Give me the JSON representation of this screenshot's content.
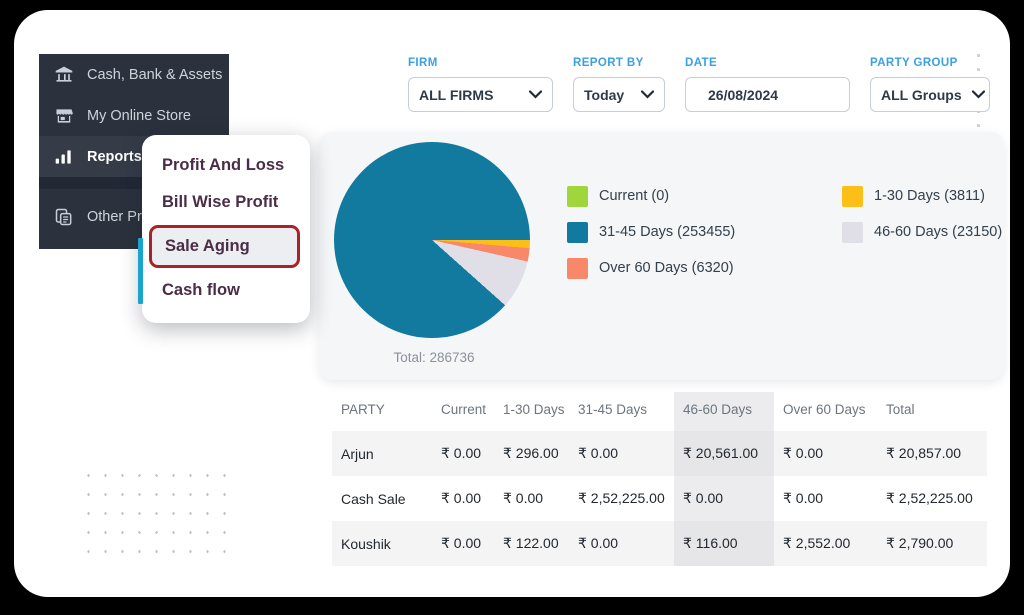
{
  "sidebar": {
    "items": [
      {
        "label": "Cash, Bank & Assets",
        "icon": "bank-icon",
        "active": false
      },
      {
        "label": "My Online Store",
        "icon": "store-icon",
        "active": false
      },
      {
        "label": "Reports",
        "icon": "bar-chart-icon",
        "active": true
      },
      {
        "label": "Other Pr",
        "icon": "documents-icon",
        "active": false
      }
    ]
  },
  "flyout": {
    "items": [
      {
        "label": "Profit And Loss",
        "selected": false
      },
      {
        "label": "Bill Wise Profit",
        "selected": false
      },
      {
        "label": "Sale Aging",
        "selected": true
      },
      {
        "label": "Cash flow",
        "selected": false
      }
    ],
    "accent_color": "#1ba3cf",
    "selected_border_color": "#a92226"
  },
  "filters": [
    {
      "label": "FIRM",
      "value": "ALL FIRMS",
      "type": "select",
      "name": "firm"
    },
    {
      "label": "REPORT BY",
      "value": "Today",
      "type": "select",
      "name": "report-by"
    },
    {
      "label": "DATE",
      "value": "26/08/2024",
      "type": "date",
      "name": "date"
    },
    {
      "label": "PARTY GROUP",
      "value": "ALL Groups",
      "type": "select",
      "name": "party-group"
    }
  ],
  "chart_data": {
    "type": "pie",
    "title": "",
    "total_label": "Total: 286736",
    "total": 286736,
    "legend_position": "right",
    "categories": [
      "Current",
      "1-30 Days",
      "31-45 Days",
      "46-60 Days",
      "Over 60 Days"
    ],
    "values": [
      0,
      3811,
      253455,
      23150,
      6320
    ],
    "labels": [
      "Current (0)",
      "1-30 Days (3811)",
      "31-45 Days (253455)",
      "46-60 Days (23150)",
      "Over 60 Days (6320)"
    ],
    "colors": [
      "#9fd63c",
      "#fcbf17",
      "#12799f",
      "#e0dfe8",
      "#f9876a"
    ],
    "legend_order": [
      "Current (0)",
      "1-30 Days (3811)",
      "31-45 Days (253455)",
      "46-60 Days (23150)",
      "Over 60 Days (6320)"
    ]
  },
  "table": {
    "columns": [
      "PARTY",
      "Current",
      "1-30 Days",
      "31-45 Days",
      "46-60 Days",
      "Over 60 Days",
      "Total"
    ],
    "highlight_column": "46-60 Days",
    "rows": [
      {
        "shaded": true,
        "cells": [
          "Arjun",
          "₹ 0.00",
          "₹ 296.00",
          "₹ 0.00",
          "₹ 20,561.00",
          "₹ 0.00",
          "₹ 20,857.00"
        ]
      },
      {
        "shaded": false,
        "cells": [
          "Cash Sale",
          "₹ 0.00",
          "₹ 0.00",
          "₹ 2,52,225.00",
          "₹ 0.00",
          "₹ 0.00",
          "₹ 2,52,225.00"
        ]
      },
      {
        "shaded": true,
        "cells": [
          "Koushik",
          "₹ 0.00",
          "₹ 122.00",
          "₹ 0.00",
          "₹ 116.00",
          "₹ 2,552.00",
          "₹ 2,790.00"
        ]
      }
    ]
  }
}
